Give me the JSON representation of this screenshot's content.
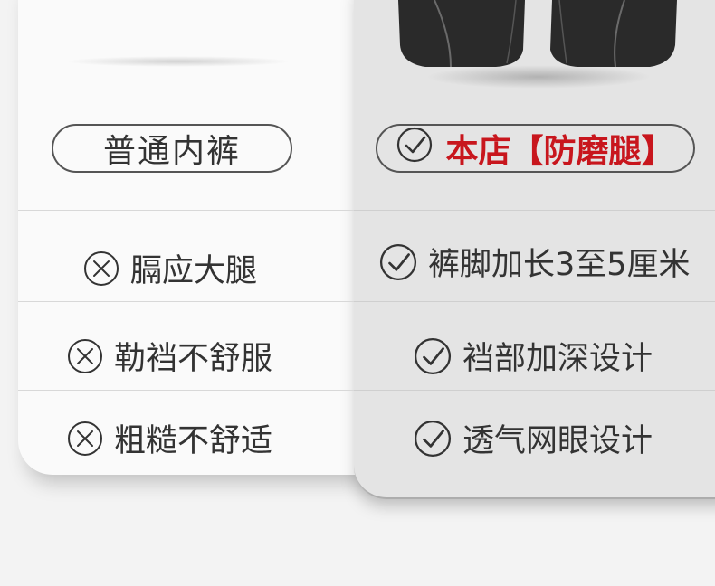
{
  "left": {
    "title": "普通内裤",
    "features": [
      "膈应大腿",
      "勒裆不舒服",
      "粗糙不舒适"
    ]
  },
  "right": {
    "title": "本店【防磨腿】",
    "features": [
      "裤脚加长3至5厘米",
      "裆部加深设计",
      "透气网眼设计"
    ]
  },
  "colors": {
    "accent": "#c8161d",
    "text": "#333333"
  },
  "icons": {
    "negative": "cross-circle-icon",
    "positive": "check-circle-icon"
  }
}
